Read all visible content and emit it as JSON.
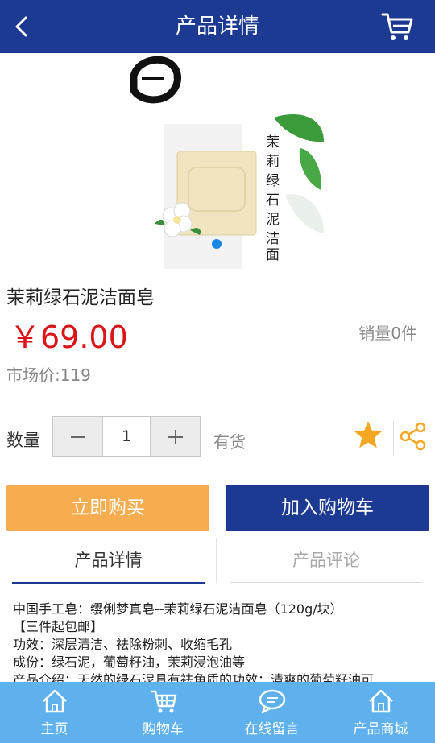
{
  "header": {
    "title": "产品详情"
  },
  "product": {
    "name": "茉莉绿石泥洁面皂",
    "price": "￥69.00",
    "sales": "销量0件",
    "market_price": "市场价:119",
    "image_caption": "茉莉绿石泥洁面皂"
  },
  "quantity": {
    "label": "数量",
    "value": "1",
    "stock": "有货"
  },
  "actions": {
    "buy_now": "立即购买",
    "add_to_cart": "加入购物车"
  },
  "tabs": [
    {
      "label": "产品详情",
      "active": true
    },
    {
      "label": "产品评论",
      "active": false
    }
  ],
  "description": [
    "中国手工皂：缨俐梦真皂--茉莉绿石泥洁面皂（120g/块）",
    "【三件起包邮】",
    "功效：深层清洁、祛除粉刺、收缩毛孔",
    "成份：绿石泥，葡萄籽油，茉莉浸泡油等",
    "产品介绍：天然的绿石泥具有祛角质的功效；清爽的葡萄籽油可"
  ],
  "bottom_nav": [
    {
      "label": "主页",
      "icon": "home-icon"
    },
    {
      "label": "购物车",
      "icon": "cart-icon"
    },
    {
      "label": "在线留言",
      "icon": "chat-icon"
    },
    {
      "label": "产品商城",
      "icon": "store-icon"
    }
  ],
  "colors": {
    "brand": "#1c3a92",
    "buy": "#f7ac4f",
    "price": "#d9161c",
    "nav": "#5fb1ee",
    "star": "#f5a623"
  }
}
